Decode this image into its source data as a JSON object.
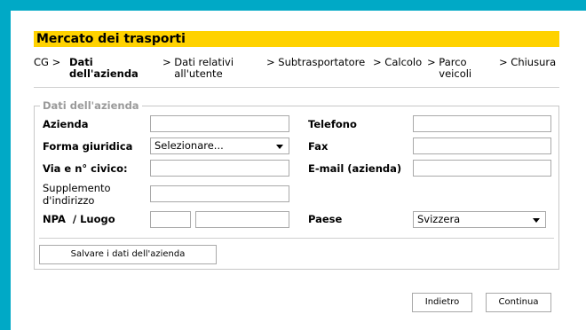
{
  "colors": {
    "frame": "#00a9c6",
    "title_bar": "#ffd200"
  },
  "title": "Mercato dei trasporti",
  "breadcrumbs": [
    {
      "label": "CG",
      "sep": ">"
    },
    {
      "label": "Dati dell'azienda",
      "sep": ">"
    },
    {
      "label": "Dati relativi all'utente",
      "sep": ">"
    },
    {
      "label": "Subtrasportatore",
      "sep": ">"
    },
    {
      "label": "Calcolo",
      "sep": ">"
    },
    {
      "label": "Parco veicoli",
      "sep": ">"
    },
    {
      "label": "Chiusura"
    }
  ],
  "form": {
    "legend": "Dati dell'azienda",
    "azienda": {
      "label": "Azienda",
      "value": ""
    },
    "forma": {
      "label": "Forma giuridica",
      "selected": "Selezionare..."
    },
    "via": {
      "label": "Via e n° civico:",
      "value": ""
    },
    "supplemento": {
      "label": "Supplemento d'indirizzo",
      "value": ""
    },
    "npa": {
      "label": "NPA  / Luogo",
      "npa_value": "",
      "luogo_value": ""
    },
    "telefono": {
      "label": "Telefono",
      "value": ""
    },
    "fax": {
      "label": "Fax",
      "value": ""
    },
    "email": {
      "label": "E-mail (azienda)",
      "value": ""
    },
    "paese": {
      "label": "Paese",
      "selected": "Svizzera"
    },
    "save_label": "Salvare i dati dell'azienda"
  },
  "nav": {
    "back_label": "Indietro",
    "next_label": "Continua"
  }
}
